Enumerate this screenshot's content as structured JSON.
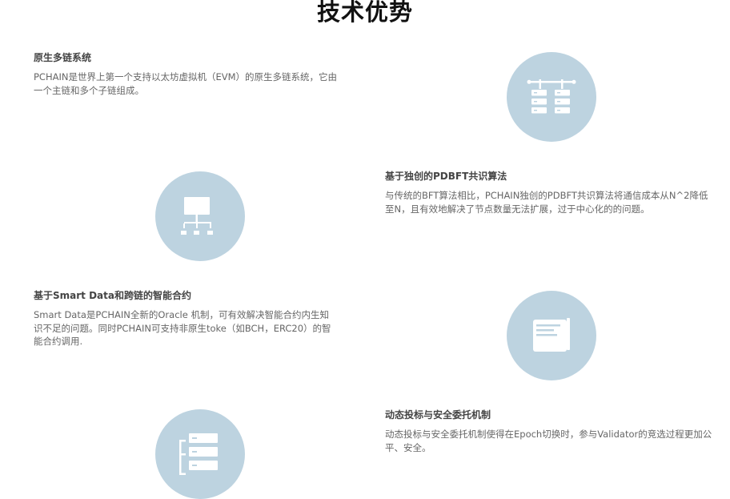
{
  "page": {
    "title": "技术优势"
  },
  "features": [
    {
      "title": "原生多链系统",
      "desc": "PCHAIN是世界上第一个支持以太坊虚拟机（EVM）的原生多链系统，它由一个主链和多个子链组成。",
      "icon": "server-rack-icon"
    },
    {
      "title": "基于独创的PDBFT共识算法",
      "desc": "与传统的BFT算法相比，PCHAIN独创的PDBFT共识算法将通信成本从N^2降低至N，且有效地解决了节点数量无法扩展，过于中心化的的问题。",
      "icon": "network-tree-icon"
    },
    {
      "title": "基于Smart Data和跨链的智能合约",
      "desc": "Smart Data是PCHAIN全新的Oracle 机制，可有效解决智能合约内生知识不足的问题。同时PCHAIN可支持非原生toke（如BCH，ERC20）的智能合约调用.",
      "icon": "document-icon"
    },
    {
      "title": "动态投标与安全委托机制",
      "desc": "动态投标与安全委托机制使得在Epoch切换时，参与Validator的竞选过程更加公平、安全。",
      "icon": "stacked-servers-icon"
    }
  ],
  "colors": {
    "icon_circle": "#bdd3e0",
    "title": "#111111",
    "heading": "#444444",
    "text": "#666666"
  }
}
